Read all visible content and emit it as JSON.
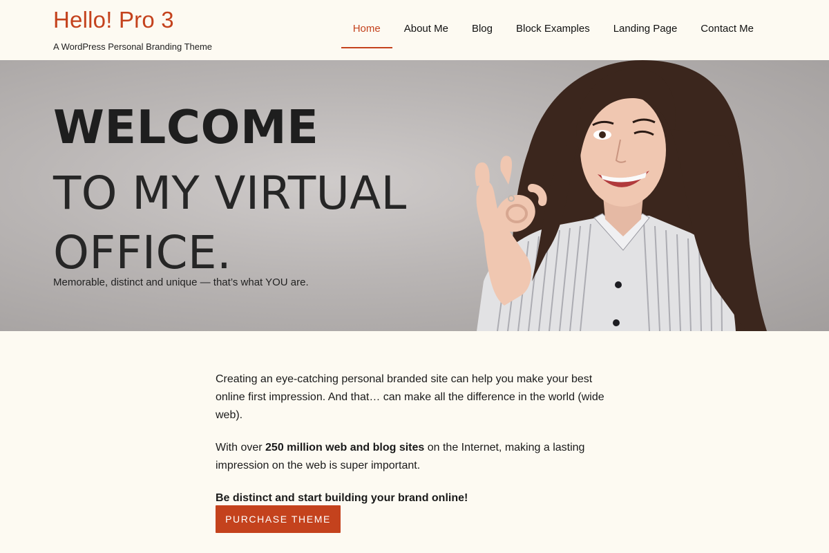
{
  "header": {
    "site_title": "Hello! Pro 3",
    "tagline": "A WordPress Personal Branding Theme"
  },
  "nav": {
    "items": [
      {
        "label": "Home",
        "active": true
      },
      {
        "label": "About Me"
      },
      {
        "label": "Blog"
      },
      {
        "label": "Block Examples"
      },
      {
        "label": "Landing Page"
      },
      {
        "label": "Contact Me"
      }
    ]
  },
  "hero": {
    "heading_bold": "WELCOME",
    "heading_line2": "TO MY VIRTUAL",
    "heading_line3": "OFFICE.",
    "subtitle": "Memorable, distinct and unique — that’s what YOU are.",
    "photo_icon": "woman-portrait-photo"
  },
  "content": {
    "p1": "Creating an eye-catching personal branded site can help you make your best online first impression. And that… can make all the difference in the world (wide web).",
    "p2_prefix": "With over ",
    "p2_bold": "250 million web and blog sites",
    "p2_suffix": " on the Internet, making a lasting impression on the web is super important.",
    "p3_bold": "Be distinct and start building your brand online!",
    "cta_label": "Purchase Theme"
  },
  "colors": {
    "accent": "#c4421d",
    "background": "#fdfaf2"
  }
}
